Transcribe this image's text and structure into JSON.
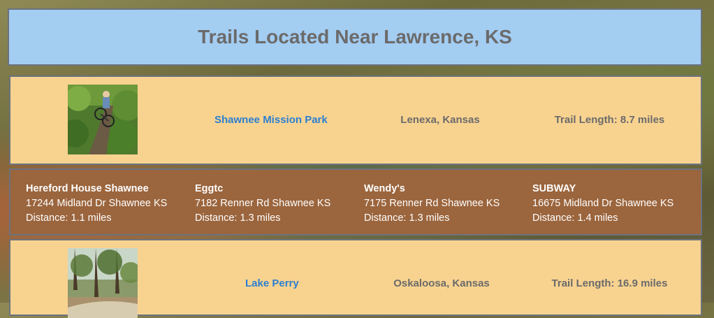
{
  "header": {
    "title": "Trails Located Near Lawrence, KS"
  },
  "trails": [
    {
      "name": "Shawnee Mission Park",
      "location": "Lenexa, Kansas",
      "length": "Trail Length: 8.7 miles",
      "photo": "mountain-biker-forest-trail"
    },
    {
      "name": "Lake Perry",
      "location": "Oskaloosa, Kansas",
      "length": "Trail Length: 16.9 miles",
      "photo": "wooded-dirt-trail"
    }
  ],
  "restaurants": [
    {
      "name": "Hereford House Shawnee",
      "address": "17244 Midland Dr Shawnee KS",
      "distance": "Distance: 1.1 miles"
    },
    {
      "name": "Eggtc",
      "address": "7182 Renner Rd Shawnee KS",
      "distance": "Distance: 1.3 miles"
    },
    {
      "name": "Wendy's",
      "address": "7175 Renner Rd Shawnee KS",
      "distance": "Distance: 1.3 miles"
    },
    {
      "name": "SUBWAY",
      "address": "16675 Midland Dr Shawnee KS",
      "distance": "Distance: 1.4 miles"
    }
  ],
  "colors": {
    "header_bg": "#a4cdf2",
    "trail_card_bg": "#f8d390",
    "restaurant_card_bg": "#9b653d",
    "link": "#2c7fd0",
    "muted_text": "#6b6b6b"
  }
}
